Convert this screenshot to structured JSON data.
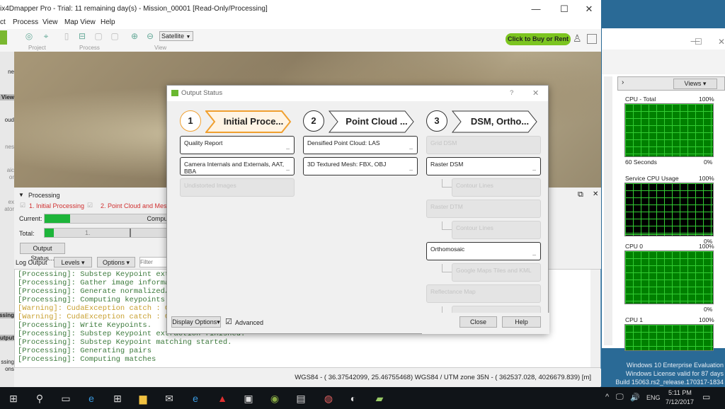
{
  "main_window": {
    "title": "ix4Dmapper Pro - Trial: 11 remaining day(s) - Mission_00001 [Read-Only/Processing]",
    "menu": [
      "ct",
      "Process",
      "View",
      "Map View",
      "Help"
    ],
    "toolbar_groups": [
      "Project",
      "Process",
      "View"
    ],
    "map_type": "Satellite",
    "buy_button": "Click to Buy or Rent",
    "sidebar_labels": [
      "ne",
      "View",
      "oud",
      "nes",
      "aic",
      "or",
      "ex",
      "ator",
      "ssing",
      "utput",
      "ssing",
      "ons"
    ]
  },
  "processing": {
    "header": "Processing",
    "steps": [
      "1. Initial Processing",
      "2. Point Cloud and Mesh"
    ],
    "current_label": "Current:",
    "current_progress": 0.2,
    "current_text": "Computi",
    "total_label": "Total:",
    "total_progress": 0.03,
    "total_text": "1.",
    "output_status_button": "Output Status..."
  },
  "log": {
    "label": "Log Output",
    "levels": "Levels",
    "options": "Options",
    "filter_placeholder": "Filter",
    "lines": [
      {
        "type": "p",
        "text": "[Processing]: Substep Keypoint extr"
      },
      {
        "type": "p",
        "text": "[Processing]: Gather image informat"
      },
      {
        "type": "p",
        "text": "[Processing]: Generate normalized/t"
      },
      {
        "type": "p",
        "text": "[Processing]: Computing keypoints"
      },
      {
        "type": "w",
        "text": "[Warning]: CudaException catch : Cu"
      },
      {
        "type": "w",
        "text": "[Warning]: CudaException catch : Cu"
      },
      {
        "type": "p",
        "text": "[Processing]: Write Keypoints."
      },
      {
        "type": "p",
        "text": "[Processing]: Substep Keypoint extraction finished."
      },
      {
        "type": "p",
        "text": "[Processing]: Substep Keypoint matching started."
      },
      {
        "type": "p",
        "text": "[Processing]: Generating pairs"
      },
      {
        "type": "p",
        "text": "[Processing]: Computing matches"
      }
    ]
  },
  "status_bar": "WGS84 - ( 36.37542099,   25.46755468)  WGS84 / UTM zone 35N - (   362537.028,    4026679.839) [m]",
  "dialog": {
    "title": "Output Status",
    "help": "?",
    "close": "✕",
    "steps": [
      {
        "num": "1",
        "label": "Initial Proce..."
      },
      {
        "num": "2",
        "label": "Point Cloud ..."
      },
      {
        "num": "3",
        "label": "DSM, Ortho..."
      }
    ],
    "col1": [
      {
        "label": "Quality Report",
        "enabled": true
      },
      {
        "label": "Camera Internals and Externals, AAT, BBA",
        "enabled": true
      },
      {
        "label": "Undistorted Images",
        "enabled": false
      }
    ],
    "col2": [
      {
        "label": "Densified Point Cloud: LAS",
        "enabled": true
      },
      {
        "label": "3D Textured Mesh: FBX, OBJ",
        "enabled": true
      }
    ],
    "col3": [
      {
        "label": "Grid DSM",
        "enabled": false
      },
      {
        "label": "Raster DSM",
        "enabled": true
      },
      {
        "label": "Contour Lines",
        "enabled": false,
        "sub": true
      },
      {
        "label": "Raster DTM",
        "enabled": false
      },
      {
        "label": "Contour Lines",
        "enabled": false,
        "sub": true
      },
      {
        "label": "Orthomosaic",
        "enabled": true
      },
      {
        "label": "Google Maps Tiles and KML",
        "enabled": false,
        "sub": true
      },
      {
        "label": "Reflectance Map",
        "enabled": false
      },
      {
        "label": "",
        "enabled": false,
        "sub": true
      }
    ],
    "dash": "_",
    "display_options": "Display Options",
    "advanced_label": "Advanced",
    "advanced_checked": true,
    "close_button": "Close",
    "help_button": "Help",
    "active_color": "#f0a030"
  },
  "perfmon": {
    "views": "Views",
    "graphs": [
      {
        "title": "CPU - Total",
        "max": "100%",
        "min": "0%",
        "footer": "60 Seconds",
        "level": 0.98
      },
      {
        "title": "Service CPU Usage",
        "max": "100%",
        "min": "0%",
        "level": 0.03
      },
      {
        "title": "CPU 0",
        "max": "100%",
        "min": "0%",
        "level": 0.98
      },
      {
        "title": "CPU 1",
        "max": "100%",
        "min": "0%",
        "level": 0.98
      }
    ]
  },
  "watermark": [
    "Windows 10 Enterprise Evaluation",
    "Windows License valid for 87 days",
    "Build 15063.rs2_release.170317-1834"
  ],
  "taskbar": {
    "language": "ENG",
    "time": "5:11 PM",
    "date": "7/12/2017"
  }
}
